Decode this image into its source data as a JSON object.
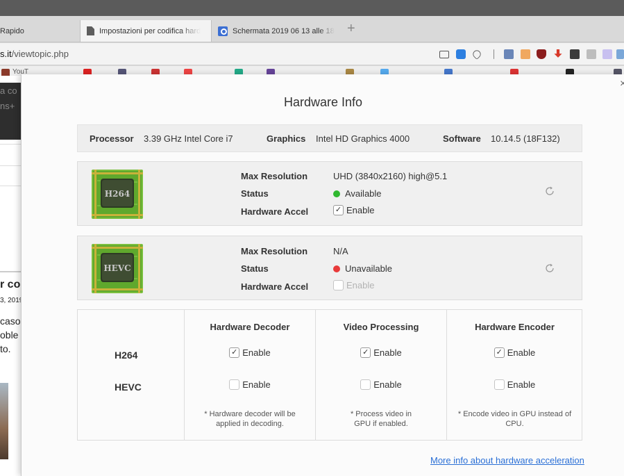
{
  "browser": {
    "tabs": [
      {
        "label": "Rapido"
      },
      {
        "label": "Impostazioni per codifica hard",
        "active": true
      },
      {
        "label": "Schermata 2019 06 13 alle 18"
      }
    ],
    "new_tab_label": "+",
    "url_prefix": "s.it",
    "url_rest": "/viewtopic.php",
    "bookmark_fragment": "YouT"
  },
  "background_page": {
    "fragments": [
      "a co",
      "ns+",
      "r co",
      "3, 2019",
      "caso",
      "oble",
      "to."
    ]
  },
  "dialog": {
    "title": "Hardware Info",
    "close_label": "×",
    "system": {
      "processor_label": "Processor",
      "processor_value": "3.39 GHz Intel Core i7",
      "graphics_label": "Graphics",
      "graphics_value": "Intel HD Graphics 4000",
      "software_label": "Software",
      "software_value": "10.14.5 (18F132)"
    },
    "codecs": [
      {
        "chip_label": "H264",
        "max_resolution_label": "Max Resolution",
        "max_resolution": "UHD (3840x2160) high@5.1",
        "status_label": "Status",
        "status": "Available",
        "status_color": "#2fb82f",
        "accel_label": "Hardware Accel",
        "accel_option": "Enable",
        "accel_checked": true
      },
      {
        "chip_label": "HEVC",
        "max_resolution_label": "Max Resolution",
        "max_resolution": "N/A",
        "status_label": "Status",
        "status": "Unavailable",
        "status_color": "#e83a3a",
        "accel_label": "Hardware Accel",
        "accel_option": "Enable",
        "accel_checked": false
      }
    ],
    "matrix": {
      "rows": [
        "H264",
        "HEVC"
      ],
      "columns": [
        {
          "header": "Hardware Decoder",
          "h264": "Enable",
          "hevc": "Enable",
          "note": "* Hardware decoder will be applied in decoding."
        },
        {
          "header": "Video Processing",
          "h264": "Enable",
          "hevc": "Enable",
          "note": "* Process video in GPU if enabled."
        },
        {
          "header": "Hardware Encoder",
          "h264": "Enable",
          "hevc": "Enable",
          "note": "* Encode video in GPU instead of CPU."
        }
      ]
    },
    "more_info_link": "More info about hardware acceleration"
  }
}
